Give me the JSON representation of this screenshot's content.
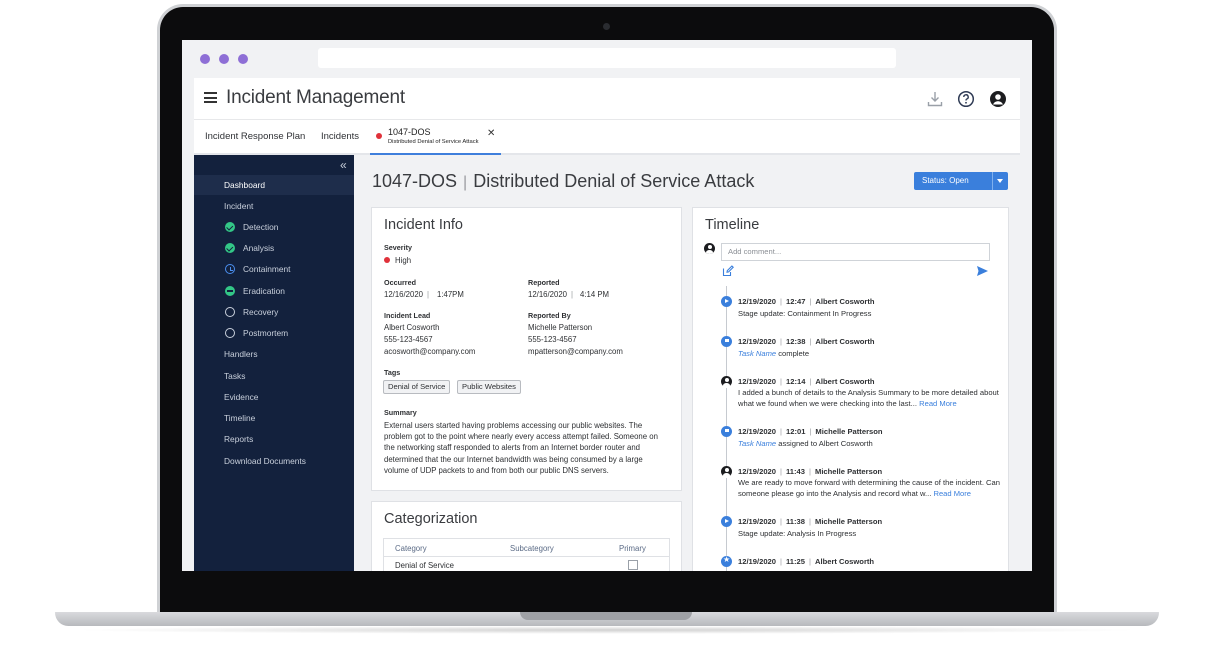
{
  "app": {
    "title": "Incident Management",
    "header_icons": [
      "download-icon",
      "help-icon",
      "account-icon"
    ]
  },
  "tabs": [
    {
      "label": "Incident Response Plan"
    },
    {
      "label": "Incidents"
    },
    {
      "id": "1047-DOS",
      "subtitle": "Distributed Denial of Service Attack",
      "status_color": "#e0313a",
      "active": true
    }
  ],
  "sidebar": {
    "items": [
      {
        "label": "Dashboard",
        "active": true
      },
      {
        "label": "Incident"
      },
      {
        "label": "Detection",
        "icon": "check-circle-icon"
      },
      {
        "label": "Analysis",
        "icon": "check-circle-icon"
      },
      {
        "label": "Containment",
        "icon": "clock-icon"
      },
      {
        "label": "Eradication",
        "icon": "minus-circle-icon"
      },
      {
        "label": "Recovery",
        "icon": "empty-circle-icon"
      },
      {
        "label": "Postmortem",
        "icon": "empty-circle-icon"
      },
      {
        "label": "Handlers"
      },
      {
        "label": "Tasks"
      },
      {
        "label": "Evidence"
      },
      {
        "label": "Timeline"
      },
      {
        "label": "Reports"
      },
      {
        "label": "Download Documents"
      }
    ]
  },
  "page": {
    "incident_id": "1047-DOS",
    "incident_name": "Distributed Denial of Service Attack",
    "status_label": "Status: Open"
  },
  "incident_info": {
    "title": "Incident Info",
    "severity_label": "Severity",
    "severity_value": "High",
    "occurred_label": "Occurred",
    "occurred_date": "12/16/2020",
    "occurred_time": "1:47PM",
    "reported_label": "Reported",
    "reported_date": "12/16/2020",
    "reported_time": "4:14 PM",
    "lead_label": "Incident Lead",
    "lead_name": "Albert Cosworth",
    "lead_phone": "555-123-4567",
    "lead_email": "acosworth@company.com",
    "reported_by_label": "Reported By",
    "reported_by_name": "Michelle Patterson",
    "reported_by_phone": "555-123-4567",
    "reported_by_email": "mpatterson@company.com",
    "tags_label": "Tags",
    "tags": [
      "Denial of Service",
      "Public Websites"
    ],
    "summary_label": "Summary",
    "summary": "External users started having problems accessing our public websites. The problem got to the point where nearly every access attempt failed. Someone on the networking staff responded to alerts from an Internet border router and determined that the our Internet bandwidth was being consumed by a large volume of UDP packets to and from both our public DNS servers."
  },
  "categorization": {
    "title": "Categorization",
    "columns": [
      "Category",
      "Subcategory",
      "Primary"
    ],
    "rows": [
      {
        "category": "Denial of Service",
        "subcategory": "",
        "primary": true
      }
    ]
  },
  "timeline": {
    "title": "Timeline",
    "comment_placeholder": "Add comment...",
    "entries": [
      {
        "icon": "play-icon",
        "date": "12/19/2020",
        "time": "12:47",
        "author": "Albert Cosworth",
        "text": "Stage update: Containment In Progress"
      },
      {
        "icon": "flag-icon",
        "date": "12/19/2020",
        "time": "12:38",
        "author": "Albert Cosworth",
        "task": "Task Name",
        "text": " complete"
      },
      {
        "icon": "user-icon",
        "date": "12/19/2020",
        "time": "12:14",
        "author": "Albert Cosworth",
        "text": "I added a bunch of details to the Analysis Summary to be more detailed about what we found when we were checking into the last...",
        "more": "Read More"
      },
      {
        "icon": "flag-icon",
        "date": "12/19/2020",
        "time": "12:01",
        "author": "Michelle Patterson",
        "task": "Task Name",
        "text": " assigned to Albert Cosworth"
      },
      {
        "icon": "user-icon",
        "date": "12/19/2020",
        "time": "11:43",
        "author": "Michelle Patterson",
        "text": "We are ready to move forward with determining the cause of the incident. Can someone please go into the Analysis and record what w...",
        "more": "Read More"
      },
      {
        "icon": "play-icon",
        "date": "12/19/2020",
        "time": "11:38",
        "author": "Michelle Patterson",
        "text": "Stage update: Analysis In Progress"
      },
      {
        "icon": "star-icon",
        "date": "12/19/2020",
        "time": "11:25",
        "author": "Albert Cosworth",
        "text": ""
      }
    ]
  },
  "colors": {
    "accent": "#3a7fdc",
    "sidebar_bg": "#13213d",
    "success": "#33c787",
    "danger": "#e0313a"
  }
}
